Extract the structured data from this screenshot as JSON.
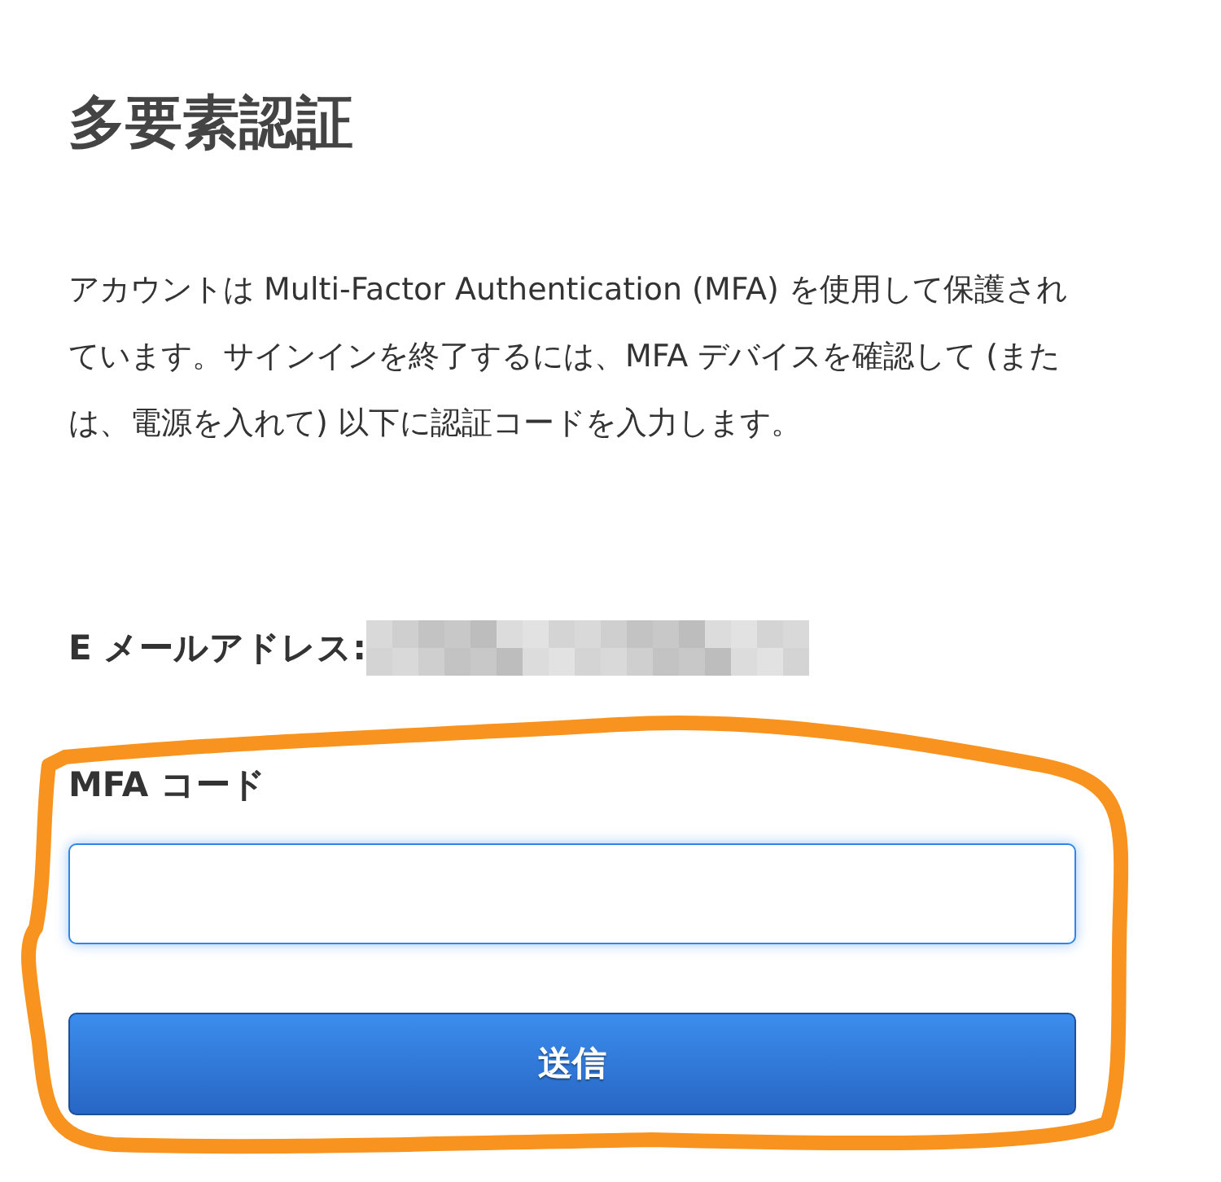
{
  "title": "多要素認証",
  "description": "アカウントは Multi-Factor Authentication (MFA) を使用して保護されています。サインインを終了するには、MFA デバイスを確認して (または、電源を入れて) 以下に認証コードを入力します。",
  "email": {
    "label": "E メールアドレス:"
  },
  "mfa_code": {
    "label": "MFA コード",
    "focused": true
  },
  "submit_button": {
    "label": "送信"
  }
}
